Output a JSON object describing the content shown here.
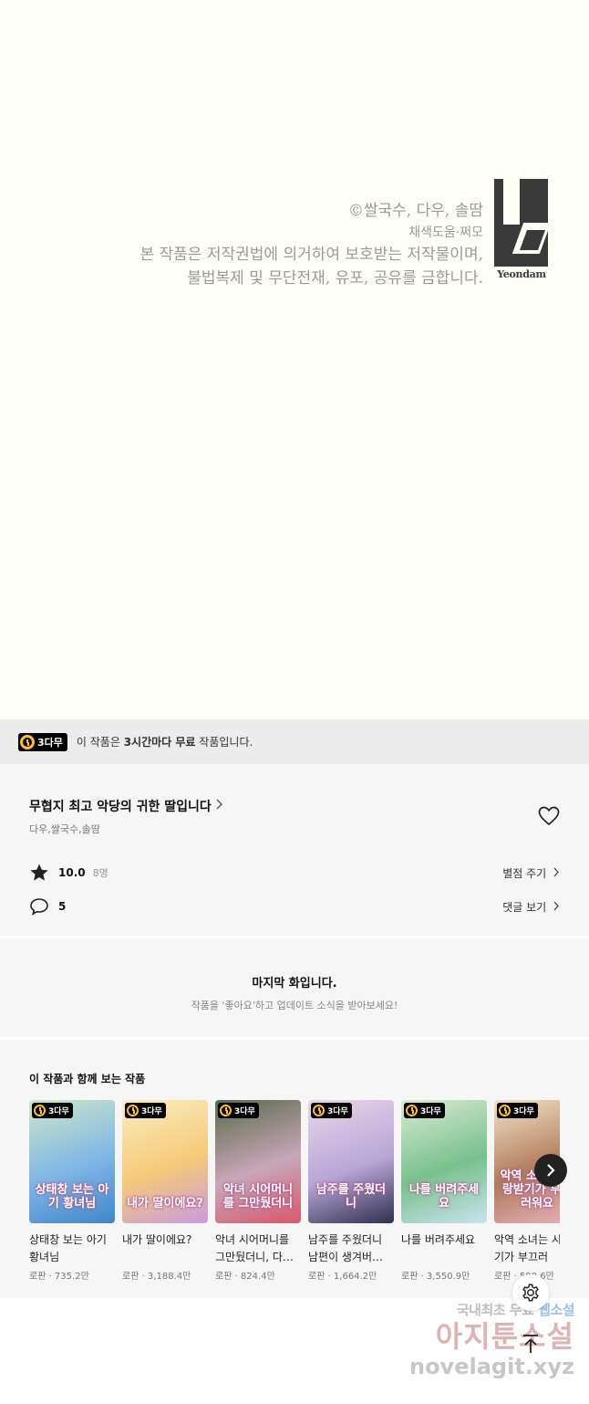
{
  "comic": {
    "credit_line1": "©쌀국수, 다우, 솔땀",
    "credit_line2": "채색도움·쩌모",
    "credit_line3": "본 작품은 저작권법에 의거하여 보호받는 저작물이며,",
    "credit_line4": "불법복제 및 무단전재, 유포, 공유를 금합니다.",
    "publisher_logo_text": "Yeondam"
  },
  "free_banner": {
    "badge": "3다무",
    "text_before": "이 작품은 ",
    "text_bold": "3시간마다 무료",
    "text_after": " 작품입니다."
  },
  "series": {
    "title": "무협지 최고 악당의 귀한 딸입니다",
    "authors": "다우,쌀국수,솔땀",
    "rating": "10.0",
    "rating_count": "8명",
    "rate_action": "별점 주기",
    "comment_count": "5",
    "comment_action": "댓글 보기"
  },
  "last_episode": {
    "title": "마지막 화입니다.",
    "subtitle": "작품을 '좋아요'하고 업데이트 소식을 받아보세요!"
  },
  "recommendations": {
    "heading": "이 작품과 함께 보는 작품",
    "badge": "3다무",
    "items": [
      {
        "name": "상태창 보는 아기 황녀님",
        "meta": "로판 · 735.2만",
        "cover_text": "상태창 보는 아기 황녀님",
        "colors": [
          "#cfe7c8",
          "#7fb6e6",
          "#3f86c9"
        ]
      },
      {
        "name": "내가 딸이에요?",
        "meta": "로판 · 3,188.4만",
        "cover_text": "내가 딸이에요?",
        "colors": [
          "#fbeec0",
          "#f5c978",
          "#c89be0"
        ]
      },
      {
        "name": "악녀 시어머니를 그만뒀더니, 다…",
        "meta": "로판 · 824.4만",
        "cover_text": "악녀 시어머니를 그만뒀더니",
        "colors": [
          "#5a6b4a",
          "#c7a6b8",
          "#d9576b"
        ]
      },
      {
        "name": "남주를 주웠더니 남편이 생겨버…",
        "meta": "로판 · 1,664.2만",
        "cover_text": "남주를 주웠더니",
        "colors": [
          "#e9d7ea",
          "#b8a6d8",
          "#2e2f4d"
        ]
      },
      {
        "name": "나를 버려주세요",
        "meta": "로판 · 3,550.9만",
        "cover_text": "나를 버려주세요",
        "colors": [
          "#d9ecd0",
          "#79c08c",
          "#c9e3f0"
        ]
      },
      {
        "name": "악역 소녀는 시 받기가 부끄러",
        "meta": "로판 · 590.6만",
        "cover_text": "악역 소녀는 사랑받기가 부끄러워요",
        "colors": [
          "#f3e3c8",
          "#b07a5a",
          "#e8b3c0"
        ]
      }
    ]
  },
  "watermark": {
    "line1_a": "국내최초 무료 ",
    "line1_b": "웹소설",
    "line2": "아지툰소설",
    "line3": "novelagit.xyz"
  },
  "icons": {
    "heart": "heart-outline-icon",
    "star": "star-filled-icon",
    "comment": "speech-bubble-icon",
    "chevron": "chevron-right-icon",
    "gear": "gear-icon",
    "top": "scroll-top-icon",
    "clock": "clock-icon"
  },
  "colors": {
    "badge_yellow": "#ffc21a",
    "comic_bg": "#fffff7",
    "section_bg": "#f6f6f6"
  }
}
